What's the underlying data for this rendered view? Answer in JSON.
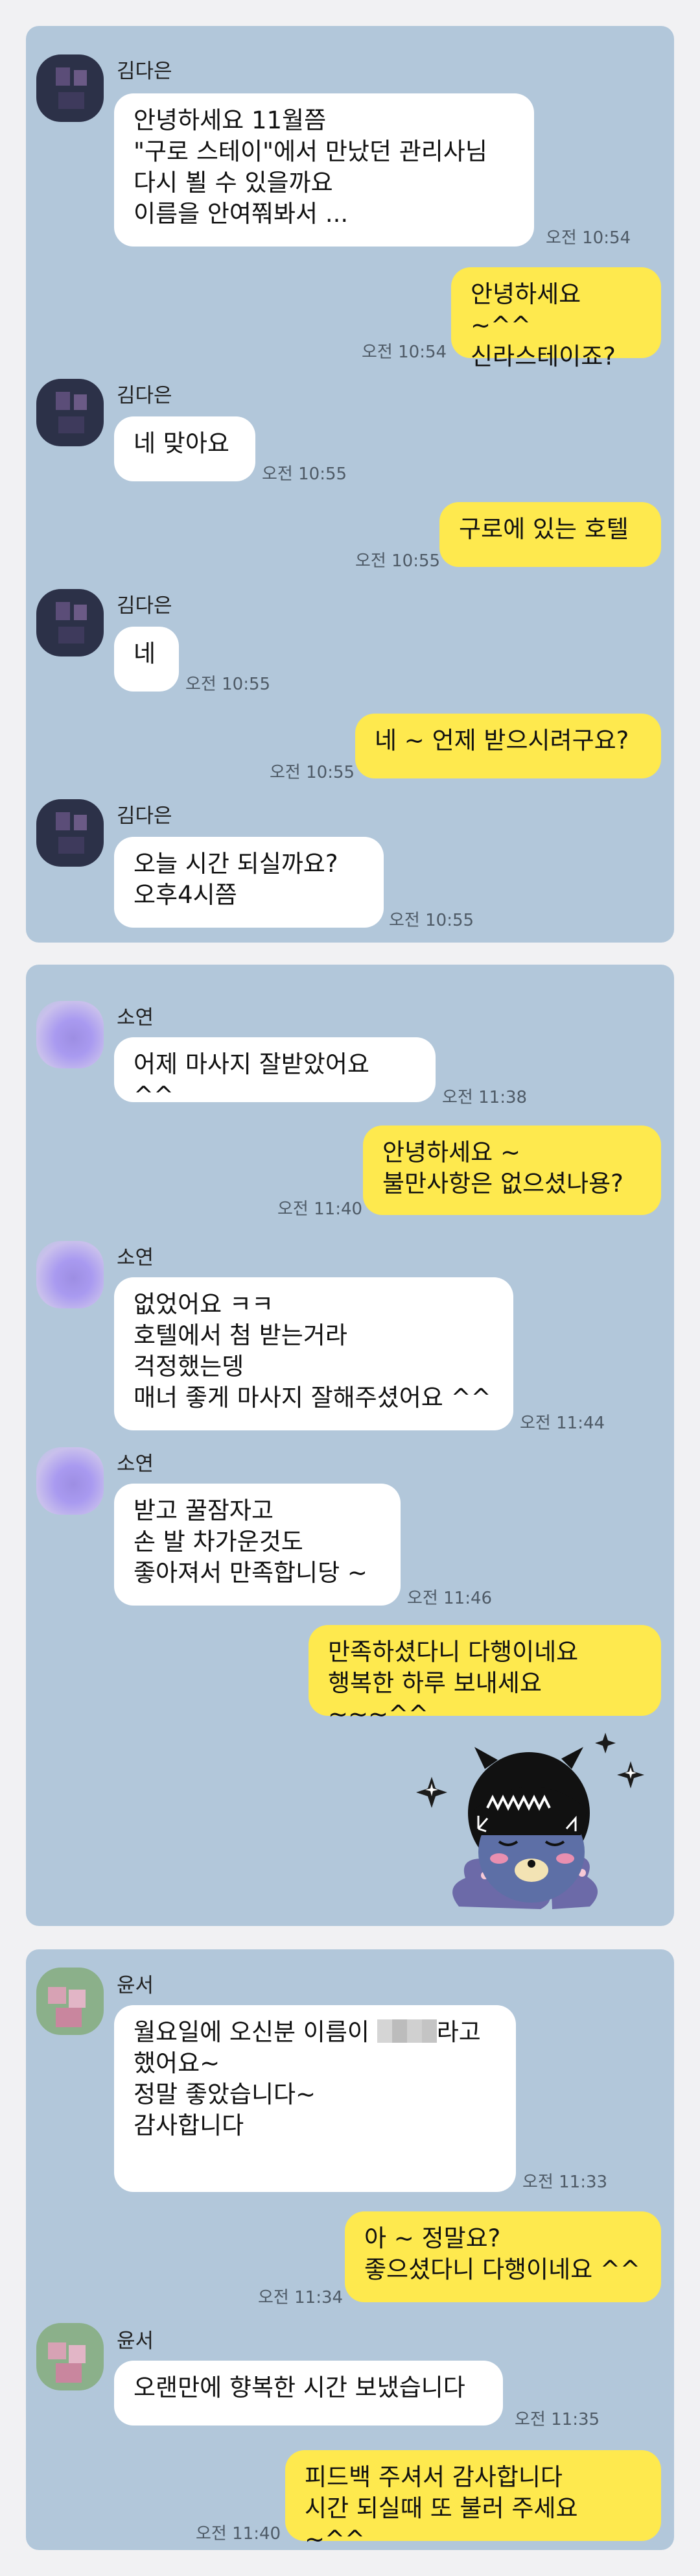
{
  "panel1": {
    "messages": [
      {
        "side": "in",
        "sender": "김다은",
        "text": "안녕하세요 11월쯤\n\"구로 스테이\"에서 만났던 관리사님\n다시 뵐 수 있을까요\n이름을 안여쭤봐서 ...",
        "time": "오전 10:54"
      },
      {
        "side": "out",
        "text": "안녕하세요 ~^^\n신라스테이죠?",
        "time": "오전 10:54"
      },
      {
        "side": "in",
        "sender": "김다은",
        "text": "네 맞아요",
        "time": "오전 10:55"
      },
      {
        "side": "out",
        "text": "구로에 있는 호텔",
        "time": "오전 10:55"
      },
      {
        "side": "in",
        "sender": "김다은",
        "text": "네",
        "time": "오전 10:55"
      },
      {
        "side": "out",
        "text": "네 ~ 언제 받으시려구요?",
        "time": "오전 10:55"
      },
      {
        "side": "in",
        "sender": "김다은",
        "text": "오늘  시간 되실까요?\n오후4시쯤",
        "time": "오전 10:55"
      }
    ]
  },
  "panel2": {
    "messages": [
      {
        "side": "in",
        "sender": "소연",
        "text": "어제 마사지 잘받았어요 ^^",
        "time": "오전 11:38"
      },
      {
        "side": "out",
        "text": "안녕하세요 ~\n불만사항은 없으셨나용?",
        "time": "오전 11:40"
      },
      {
        "side": "in",
        "sender": "소연",
        "text": "없었어요 ㅋㅋ\n호텔에서 첨 받는거라\n걱정했는뎅\n매너 좋게 마사지 잘해주셨어요 ^^",
        "time": "오전 11:44"
      },
      {
        "side": "in",
        "sender": "소연",
        "text": "받고 꿀잠자고\n손 발 차가운것도\n좋아져서 만족합니당 ~",
        "time": "오전 11:46"
      },
      {
        "side": "out",
        "text": "만족하셨다니 다행이네요\n행복한 하루 보내세요 ~~~^^"
      }
    ],
    "emoticon": "kakao-character-sticker"
  },
  "panel3": {
    "messages": [
      {
        "side": "in",
        "sender": "윤서",
        "text_before": "월요일에 오신분 이름이 ",
        "text_after": "라고\n했어요~\n정말 좋았습니다~\n감사합니다",
        "time": "오전 11:33"
      },
      {
        "side": "out",
        "text": "아 ~ 정말요?\n좋으셨다니 다행이네요 ^^",
        "time": "오전 11:34"
      },
      {
        "side": "in",
        "sender": "윤서",
        "text": "오랜만에 향복한 시간 보냈습니다",
        "time": "오전 11:35"
      },
      {
        "side": "out",
        "text": "피드백 주셔서 감사합니다\n시간 되실때 또 불러 주세요 ~^^",
        "time": "오전 11:40"
      }
    ]
  },
  "colors": {
    "panel_bg": "#b2c7da",
    "incoming_bubble": "#ffffff",
    "outgoing_bubble": "#fee94e",
    "page_bg": "#f1f1f3"
  }
}
